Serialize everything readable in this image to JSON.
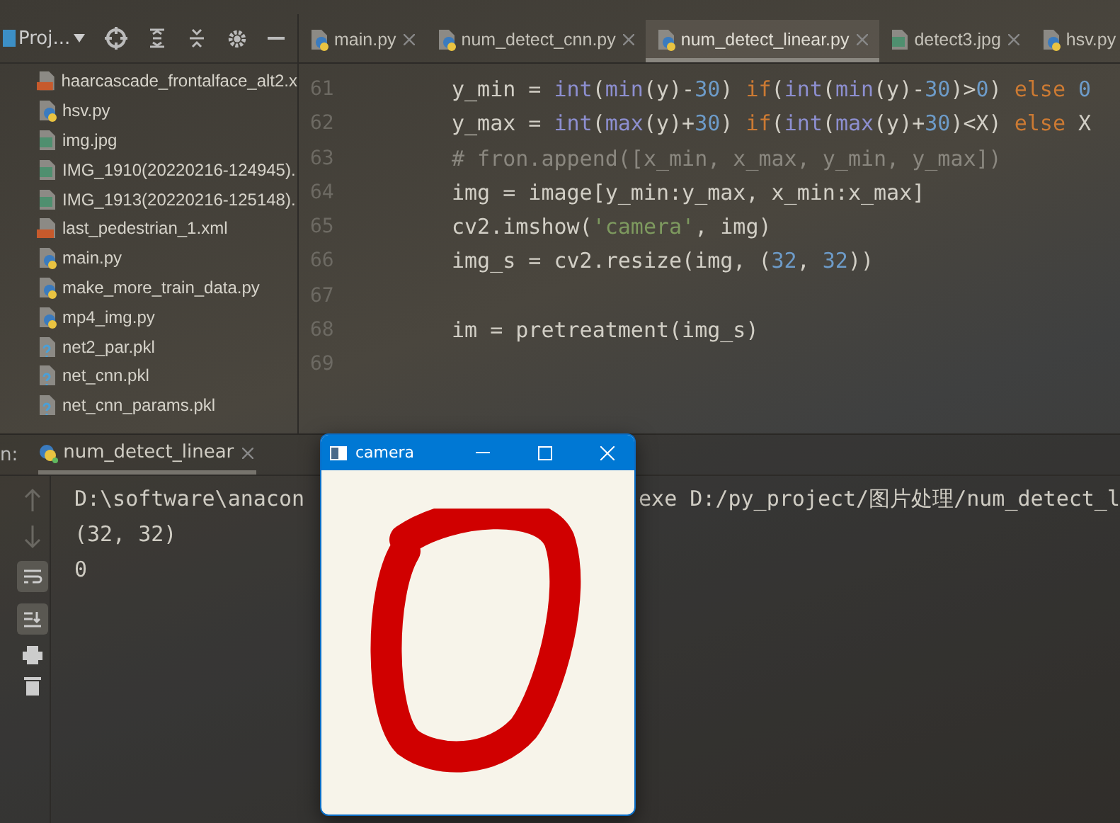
{
  "project": {
    "title": "Proj...",
    "files": [
      {
        "name": "haarcascade_frontalface_alt2.x",
        "kind": "xml"
      },
      {
        "name": "hsv.py",
        "kind": "py"
      },
      {
        "name": "img.jpg",
        "kind": "image"
      },
      {
        "name": "IMG_1910(20220216-124945).",
        "kind": "image"
      },
      {
        "name": "IMG_1913(20220216-125148).",
        "kind": "image"
      },
      {
        "name": "last_pedestrian_1.xml",
        "kind": "xml"
      },
      {
        "name": "main.py",
        "kind": "py"
      },
      {
        "name": "make_more_train_data.py",
        "kind": "py"
      },
      {
        "name": "mp4_img.py",
        "kind": "py"
      },
      {
        "name": "net2_par.pkl",
        "kind": "pkl"
      },
      {
        "name": "net_cnn.pkl",
        "kind": "pkl"
      },
      {
        "name": "net_cnn_params.pkl",
        "kind": "pkl"
      }
    ]
  },
  "tabs": [
    {
      "label": "main.py",
      "kind": "py",
      "selected": false,
      "closable": true
    },
    {
      "label": "num_detect_cnn.py",
      "kind": "py",
      "selected": false,
      "closable": true
    },
    {
      "label": "num_detect_linear.py",
      "kind": "py",
      "selected": true,
      "closable": true
    },
    {
      "label": "detect3.jpg",
      "kind": "image",
      "selected": false,
      "closable": true
    },
    {
      "label": "hsv.py",
      "kind": "py",
      "selected": false,
      "closable": false
    }
  ],
  "code": [
    {
      "number": "61",
      "tokens": [
        {
          "t": "y_min = ",
          "kind": "plain"
        },
        {
          "t": "int",
          "kind": "builtin"
        },
        {
          "t": "(",
          "kind": "plain"
        },
        {
          "t": "min",
          "kind": "builtin"
        },
        {
          "t": "(y)-",
          "kind": "plain"
        },
        {
          "t": "30",
          "kind": "number"
        },
        {
          "t": ") ",
          "kind": "plain"
        },
        {
          "t": "if",
          "kind": "keyword"
        },
        {
          "t": "(",
          "kind": "plain"
        },
        {
          "t": "int",
          "kind": "builtin"
        },
        {
          "t": "(",
          "kind": "plain"
        },
        {
          "t": "min",
          "kind": "builtin"
        },
        {
          "t": "(y)-",
          "kind": "plain"
        },
        {
          "t": "30",
          "kind": "number"
        },
        {
          "t": ")>",
          "kind": "plain"
        },
        {
          "t": "0",
          "kind": "number"
        },
        {
          "t": ") ",
          "kind": "plain"
        },
        {
          "t": "else ",
          "kind": "keyword"
        },
        {
          "t": "0",
          "kind": "number"
        }
      ]
    },
    {
      "number": "62",
      "tokens": [
        {
          "t": "y_max = ",
          "kind": "plain"
        },
        {
          "t": "int",
          "kind": "builtin"
        },
        {
          "t": "(",
          "kind": "plain"
        },
        {
          "t": "max",
          "kind": "builtin"
        },
        {
          "t": "(y)+",
          "kind": "plain"
        },
        {
          "t": "30",
          "kind": "number"
        },
        {
          "t": ") ",
          "kind": "plain"
        },
        {
          "t": "if",
          "kind": "keyword"
        },
        {
          "t": "(",
          "kind": "plain"
        },
        {
          "t": "int",
          "kind": "builtin"
        },
        {
          "t": "(",
          "kind": "plain"
        },
        {
          "t": "max",
          "kind": "builtin"
        },
        {
          "t": "(y)+",
          "kind": "plain"
        },
        {
          "t": "30",
          "kind": "number"
        },
        {
          "t": ")<X) ",
          "kind": "plain"
        },
        {
          "t": "else",
          "kind": "keyword"
        },
        {
          "t": " X",
          "kind": "plain"
        }
      ]
    },
    {
      "number": "63",
      "tokens": [
        {
          "t": "# fron.append([x_min, x_max, y_min, y_max])",
          "kind": "comment"
        }
      ]
    },
    {
      "number": "64",
      "tokens": [
        {
          "t": "img = image[y_min:y_max, x_min:x_max]",
          "kind": "plain"
        }
      ]
    },
    {
      "number": "65",
      "tokens": [
        {
          "t": "cv2.imshow(",
          "kind": "plain"
        },
        {
          "t": "'camera'",
          "kind": "string"
        },
        {
          "t": ", img)",
          "kind": "plain"
        }
      ]
    },
    {
      "number": "66",
      "tokens": [
        {
          "t": "img_s = cv2.resize(img, (",
          "kind": "plain"
        },
        {
          "t": "32",
          "kind": "number"
        },
        {
          "t": ", ",
          "kind": "plain"
        },
        {
          "t": "32",
          "kind": "number"
        },
        {
          "t": "))",
          "kind": "plain"
        }
      ]
    },
    {
      "number": "67"
    },
    {
      "number": "68",
      "tokens": [
        {
          "t": "im = pretreatment(img_s)",
          "kind": "plain"
        }
      ]
    },
    {
      "number": "69"
    }
  ],
  "run": {
    "label": "n:",
    "tab": "num_detect_linear"
  },
  "console": {
    "first_line_left": "D:\\software\\anacon",
    "first_line_right": "exe D:/py_project/图片处理/num_detect_l",
    "lines": [
      "(32, 32)",
      "0"
    ]
  },
  "camera_window": {
    "title": "camera"
  }
}
